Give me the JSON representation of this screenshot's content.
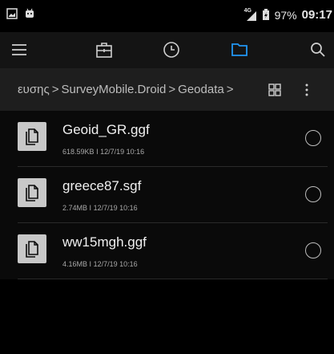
{
  "status_bar": {
    "network": "4G",
    "battery": "97%",
    "time": "09:17"
  },
  "toolbar": {
    "icons": [
      "menu-icon",
      "briefcase-icon",
      "clock-icon",
      "folder-icon",
      "search-icon"
    ],
    "active": "folder-icon",
    "accent": "#2196f3"
  },
  "path": {
    "segments": [
      "ευσης",
      "SurveyMobile.Droid",
      "Geodata"
    ],
    "separator": ">"
  },
  "files": [
    {
      "name": "Geoid_GR.ggf",
      "size": "618.59KB",
      "date": "12/7/19 10:16"
    },
    {
      "name": "greece87.sgf",
      "size": "2.74MB",
      "date": "12/7/19 10:16"
    },
    {
      "name": "ww15mgh.ggf",
      "size": "4.16MB",
      "date": "12/7/19 10:16"
    }
  ],
  "meta_separator": "I"
}
